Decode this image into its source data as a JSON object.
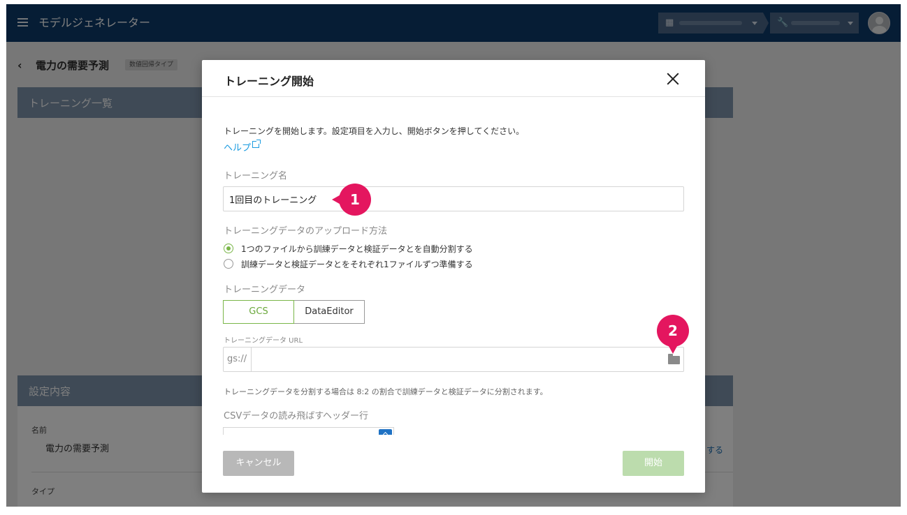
{
  "header": {
    "app_title": "モデルジェネレーター"
  },
  "page": {
    "title": "電力の需要予測",
    "type_badge": "数値回帰タイプ",
    "sections": {
      "list_title": "トレーニング一覧",
      "settings_title": "設定内容"
    },
    "settings": {
      "name_label": "名前",
      "name_value": "電力の需要予測",
      "type_label": "タイプ",
      "side_link": "する"
    }
  },
  "dialog": {
    "title": "トレーニング開始",
    "intro": "トレーニングを開始します。設定項目を入力し、開始ボタンを押してください。",
    "help_link": "ヘルプ",
    "training_name": {
      "label": "トレーニング名",
      "value": "1回目のトレーニング"
    },
    "upload_method": {
      "label": "トレーニングデータのアップロード方法",
      "options": [
        {
          "label": "1つのファイルから訓練データと検証データとを自動分割する",
          "selected": true
        },
        {
          "label": "訓練データと検証データとをそれぞれ1ファイルずつ準備する",
          "selected": false
        }
      ]
    },
    "training_data": {
      "label": "トレーニングデータ",
      "tabs": [
        {
          "label": "GCS",
          "active": true
        },
        {
          "label": "DataEditor",
          "active": false
        }
      ],
      "url_label": "トレーニングデータ URL",
      "url_prefix": "gs://",
      "url_value": "",
      "note": "トレーニングデータを分割する場合は 8:2 の割合で訓練データと検証データに分割されます。"
    },
    "csv_skip": {
      "label": "CSVデータの読み飛ばすヘッダー行"
    },
    "buttons": {
      "cancel": "キャンセル",
      "start": "開始"
    }
  },
  "callouts": [
    "1",
    "2"
  ],
  "colors": {
    "header_bg": "#0d3a6a",
    "accent_green": "#7ab648",
    "link_blue": "#1a9be0",
    "callout": "#e4165f"
  }
}
